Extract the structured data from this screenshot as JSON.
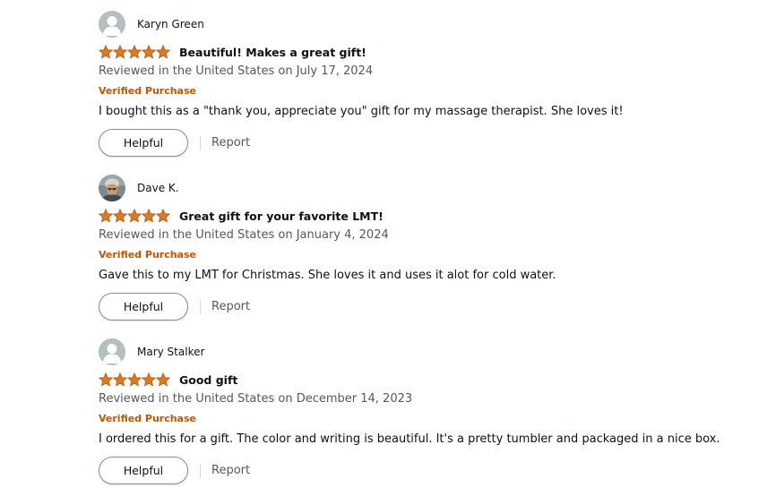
{
  "colors": {
    "star": "#de7921",
    "verified": "#c45500",
    "muted_text": "#565959",
    "text": "#0f1111"
  },
  "reviews": [
    {
      "reviewer": "Karyn Green",
      "avatar": "default-avatar-icon",
      "rating": 5,
      "title": "Beautiful! Makes a great gift!",
      "date": "Reviewed in the United States on July 17, 2024",
      "verified": "Verified Purchase",
      "body": "I bought this as a \"thank you, appreciate you\" gift for my massage therapist. She loves it!",
      "helpful_label": "Helpful",
      "report_label": "Report"
    },
    {
      "reviewer": "Dave K.",
      "avatar": "photo-avatar",
      "rating": 5,
      "title": "Great gift for your favorite LMT!",
      "date": "Reviewed in the United States on January 4, 2024",
      "verified": "Verified Purchase",
      "body": "Gave this to my LMT for Christmas. She loves it and uses it alot for cold water.",
      "helpful_label": "Helpful",
      "report_label": "Report"
    },
    {
      "reviewer": "Mary Stalker",
      "avatar": "default-avatar-icon",
      "rating": 5,
      "title": "Good gift",
      "date": "Reviewed in the United States on December 14, 2023",
      "verified": "Verified Purchase",
      "body": "I ordered this for a gift. The color and writing is beautiful. It's a pretty tumbler and packaged in a nice box.",
      "helpful_label": "Helpful",
      "report_label": "Report"
    }
  ]
}
